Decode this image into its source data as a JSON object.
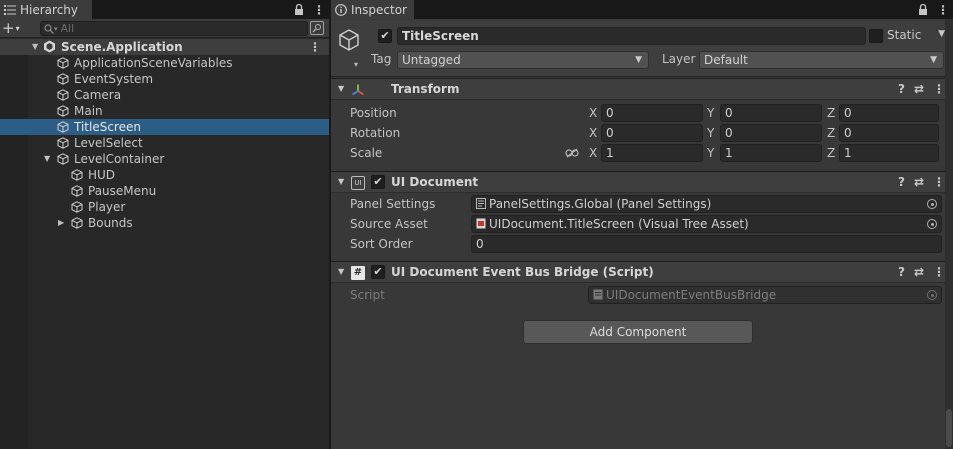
{
  "hierarchy": {
    "tab_label": "Hierarchy",
    "search_placeholder": "All",
    "scene_name": "Scene.Application",
    "items": [
      {
        "label": "ApplicationSceneVariables",
        "depth": 1,
        "expanded": null,
        "selected": false
      },
      {
        "label": "EventSystem",
        "depth": 1,
        "expanded": null,
        "selected": false
      },
      {
        "label": "Camera",
        "depth": 1,
        "expanded": null,
        "selected": false
      },
      {
        "label": "Main",
        "depth": 1,
        "expanded": null,
        "selected": false
      },
      {
        "label": "TitleScreen",
        "depth": 1,
        "expanded": null,
        "selected": true
      },
      {
        "label": "LevelSelect",
        "depth": 1,
        "expanded": null,
        "selected": false
      },
      {
        "label": "LevelContainer",
        "depth": 1,
        "expanded": true,
        "selected": false
      },
      {
        "label": "HUD",
        "depth": 2,
        "expanded": null,
        "selected": false
      },
      {
        "label": "PauseMenu",
        "depth": 2,
        "expanded": null,
        "selected": false
      },
      {
        "label": "Player",
        "depth": 2,
        "expanded": null,
        "selected": false
      },
      {
        "label": "Bounds",
        "depth": 2,
        "expanded": false,
        "selected": false
      }
    ]
  },
  "inspector": {
    "tab_label": "Inspector",
    "object_name": "TitleScreen",
    "active": true,
    "static_label": "Static",
    "static_checked": false,
    "tag_label": "Tag",
    "tag_value": "Untagged",
    "layer_label": "Layer",
    "layer_value": "Default",
    "transform": {
      "title": "Transform",
      "position_label": "Position",
      "rotation_label": "Rotation",
      "scale_label": "Scale",
      "axis_x": "X",
      "axis_y": "Y",
      "axis_z": "Z",
      "position": {
        "x": "0",
        "y": "0",
        "z": "0"
      },
      "rotation": {
        "x": "0",
        "y": "0",
        "z": "0"
      },
      "scale": {
        "x": "1",
        "y": "1",
        "z": "1"
      }
    },
    "ui_document": {
      "icon_text": "UI",
      "title": "UI Document",
      "enabled": true,
      "panel_settings_label": "Panel Settings",
      "panel_settings_value": "PanelSettings.Global (Panel Settings)",
      "source_asset_label": "Source Asset",
      "source_asset_value": "UIDocument.TitleScreen (Visual Tree Asset)",
      "sort_order_label": "Sort Order",
      "sort_order_value": "0"
    },
    "event_bus_bridge": {
      "icon_text": "#",
      "title": "UI Document Event Bus Bridge (Script)",
      "enabled": true,
      "script_label": "Script",
      "script_value": "UIDocumentEventBusBridge"
    },
    "add_component_label": "Add Component"
  },
  "colors": {
    "selection": "#2c5d87",
    "panel_bg": "#383838",
    "header_bg": "#3e3e3e",
    "field_bg": "#2a2a2a"
  }
}
